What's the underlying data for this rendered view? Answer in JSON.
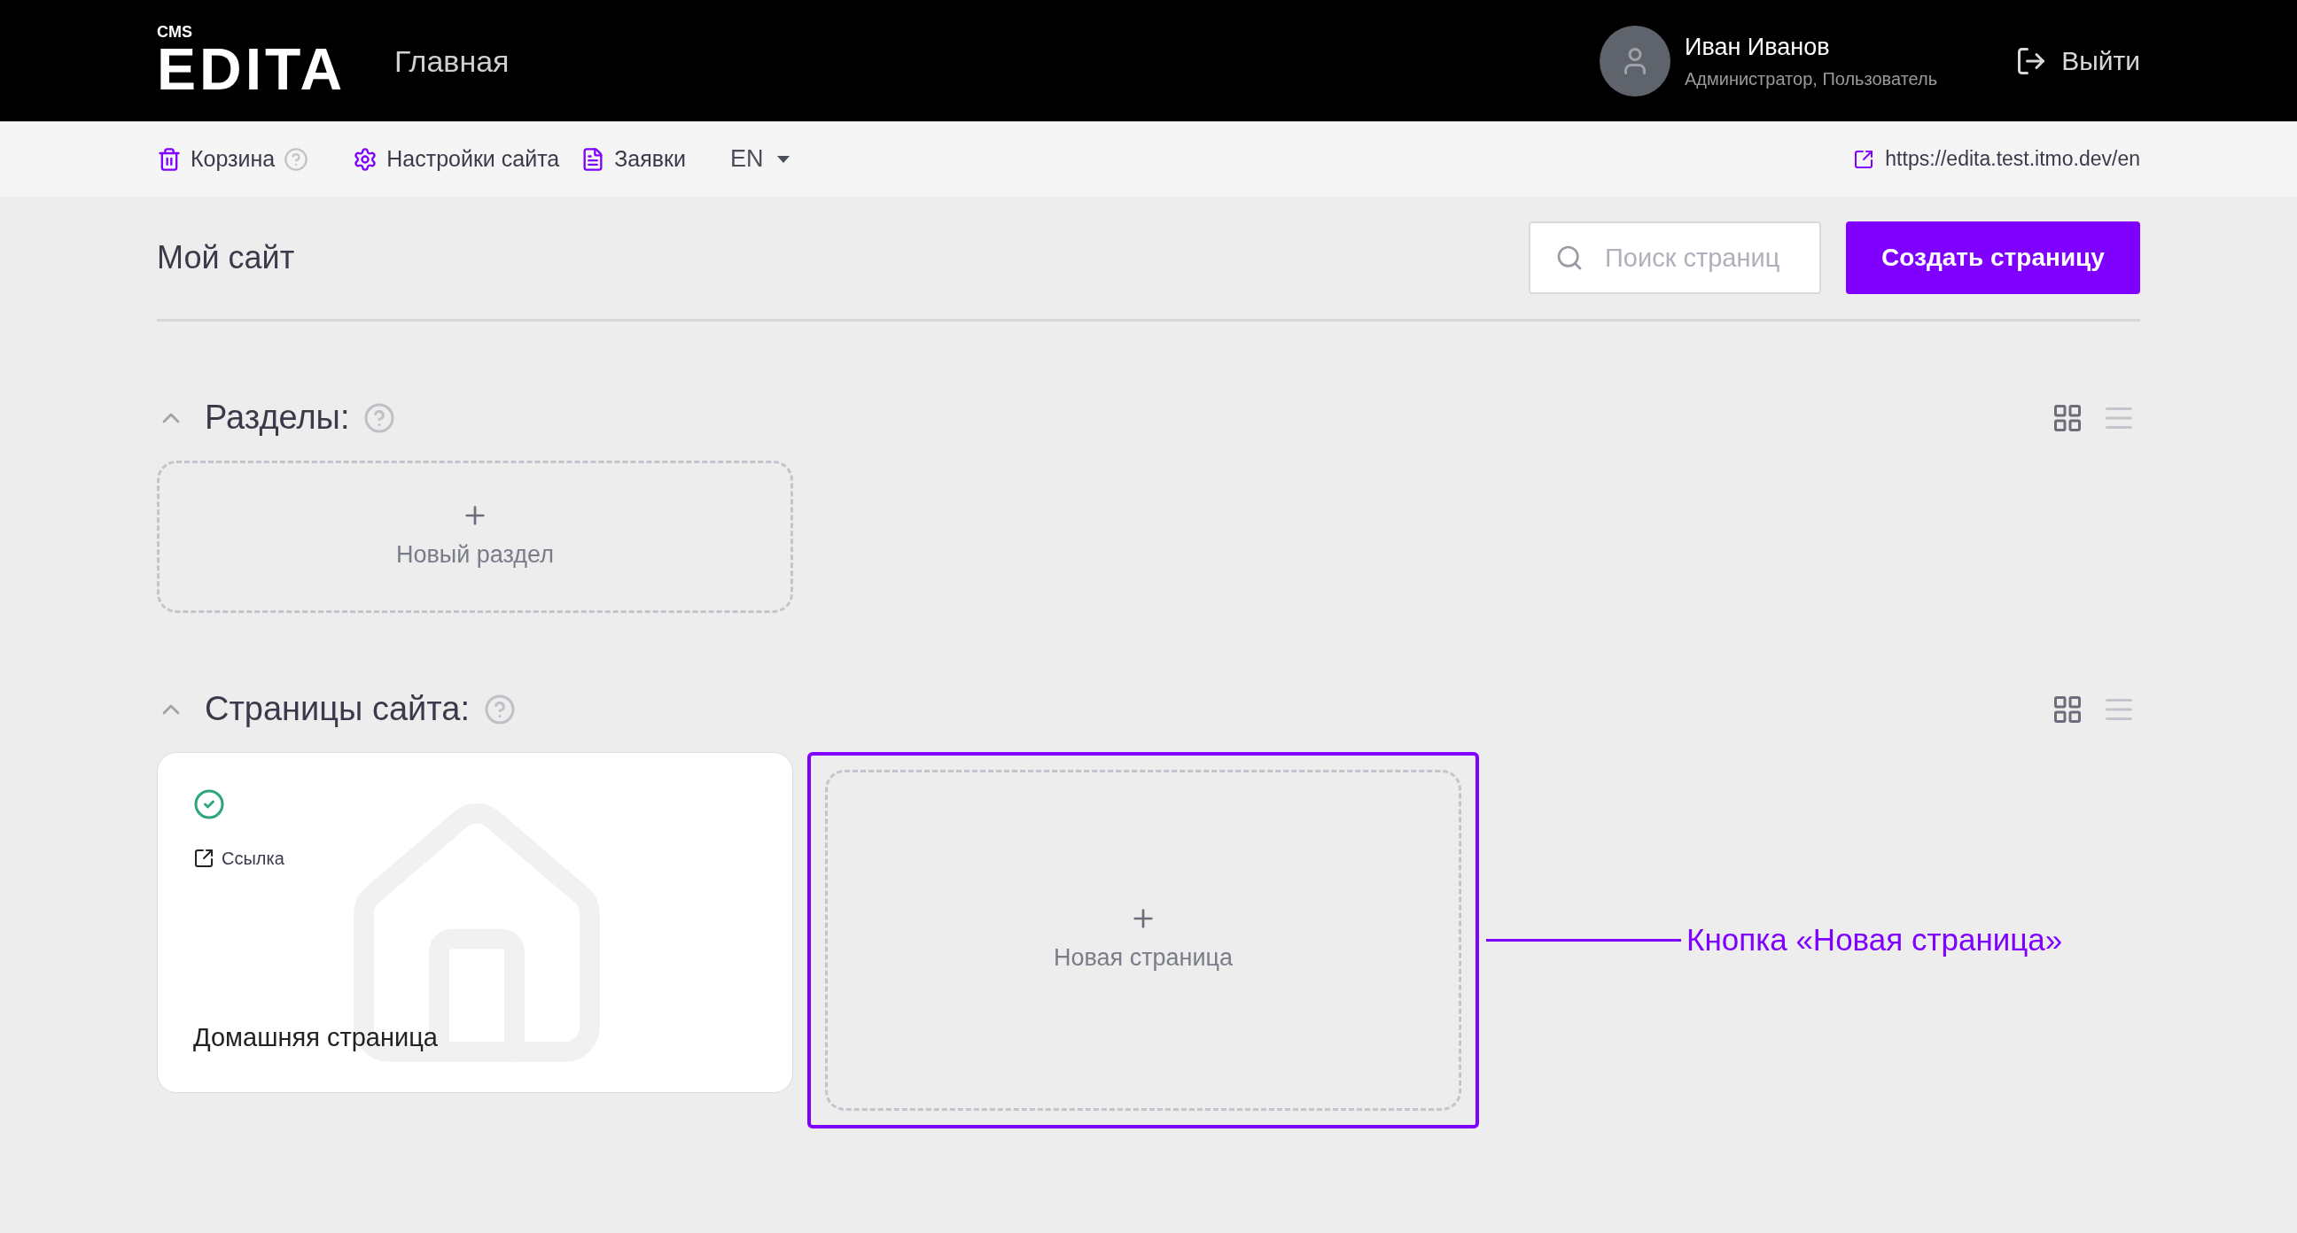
{
  "header": {
    "logo_small": "CMS",
    "logo": "EDITA",
    "page_title": "Главная",
    "user": {
      "name": "Иван Иванов",
      "roles": "Администратор, Пользователь"
    },
    "logout": "Выйти"
  },
  "toolbar": {
    "items": [
      {
        "kind": "trash",
        "label": "Корзина",
        "help": true
      },
      {
        "kind": "settings",
        "label": "Настройки сайта",
        "help": false
      },
      {
        "kind": "requests",
        "label": "Заявки",
        "help": false
      }
    ],
    "language": "EN",
    "site_link": "https://edita.test.itmo.dev/en"
  },
  "site": {
    "title": "Мой сайт",
    "search": {
      "placeholder": "Поиск страниц"
    },
    "create_button": "Создать страницу"
  },
  "sections": [
    {
      "title": "Разделы:",
      "expanded": true,
      "views": [
        {
          "kind": "grid",
          "selected": true
        },
        {
          "kind": "list",
          "selected": false
        }
      ],
      "cards": [
        {
          "kind": "new",
          "label": "Новый раздел",
          "highlighted": false
        }
      ]
    },
    {
      "title": "Страницы сайта:",
      "expanded": true,
      "views": [
        {
          "kind": "grid",
          "selected": true
        },
        {
          "kind": "list",
          "selected": false
        }
      ],
      "cards": [
        {
          "kind": "page",
          "title": "Домашняя страница",
          "link": "Ссылка",
          "published": true
        },
        {
          "kind": "new",
          "label": "Новая страница",
          "highlighted": true,
          "annotation": "Кнопка «Новая страница»"
        }
      ]
    }
  ]
}
